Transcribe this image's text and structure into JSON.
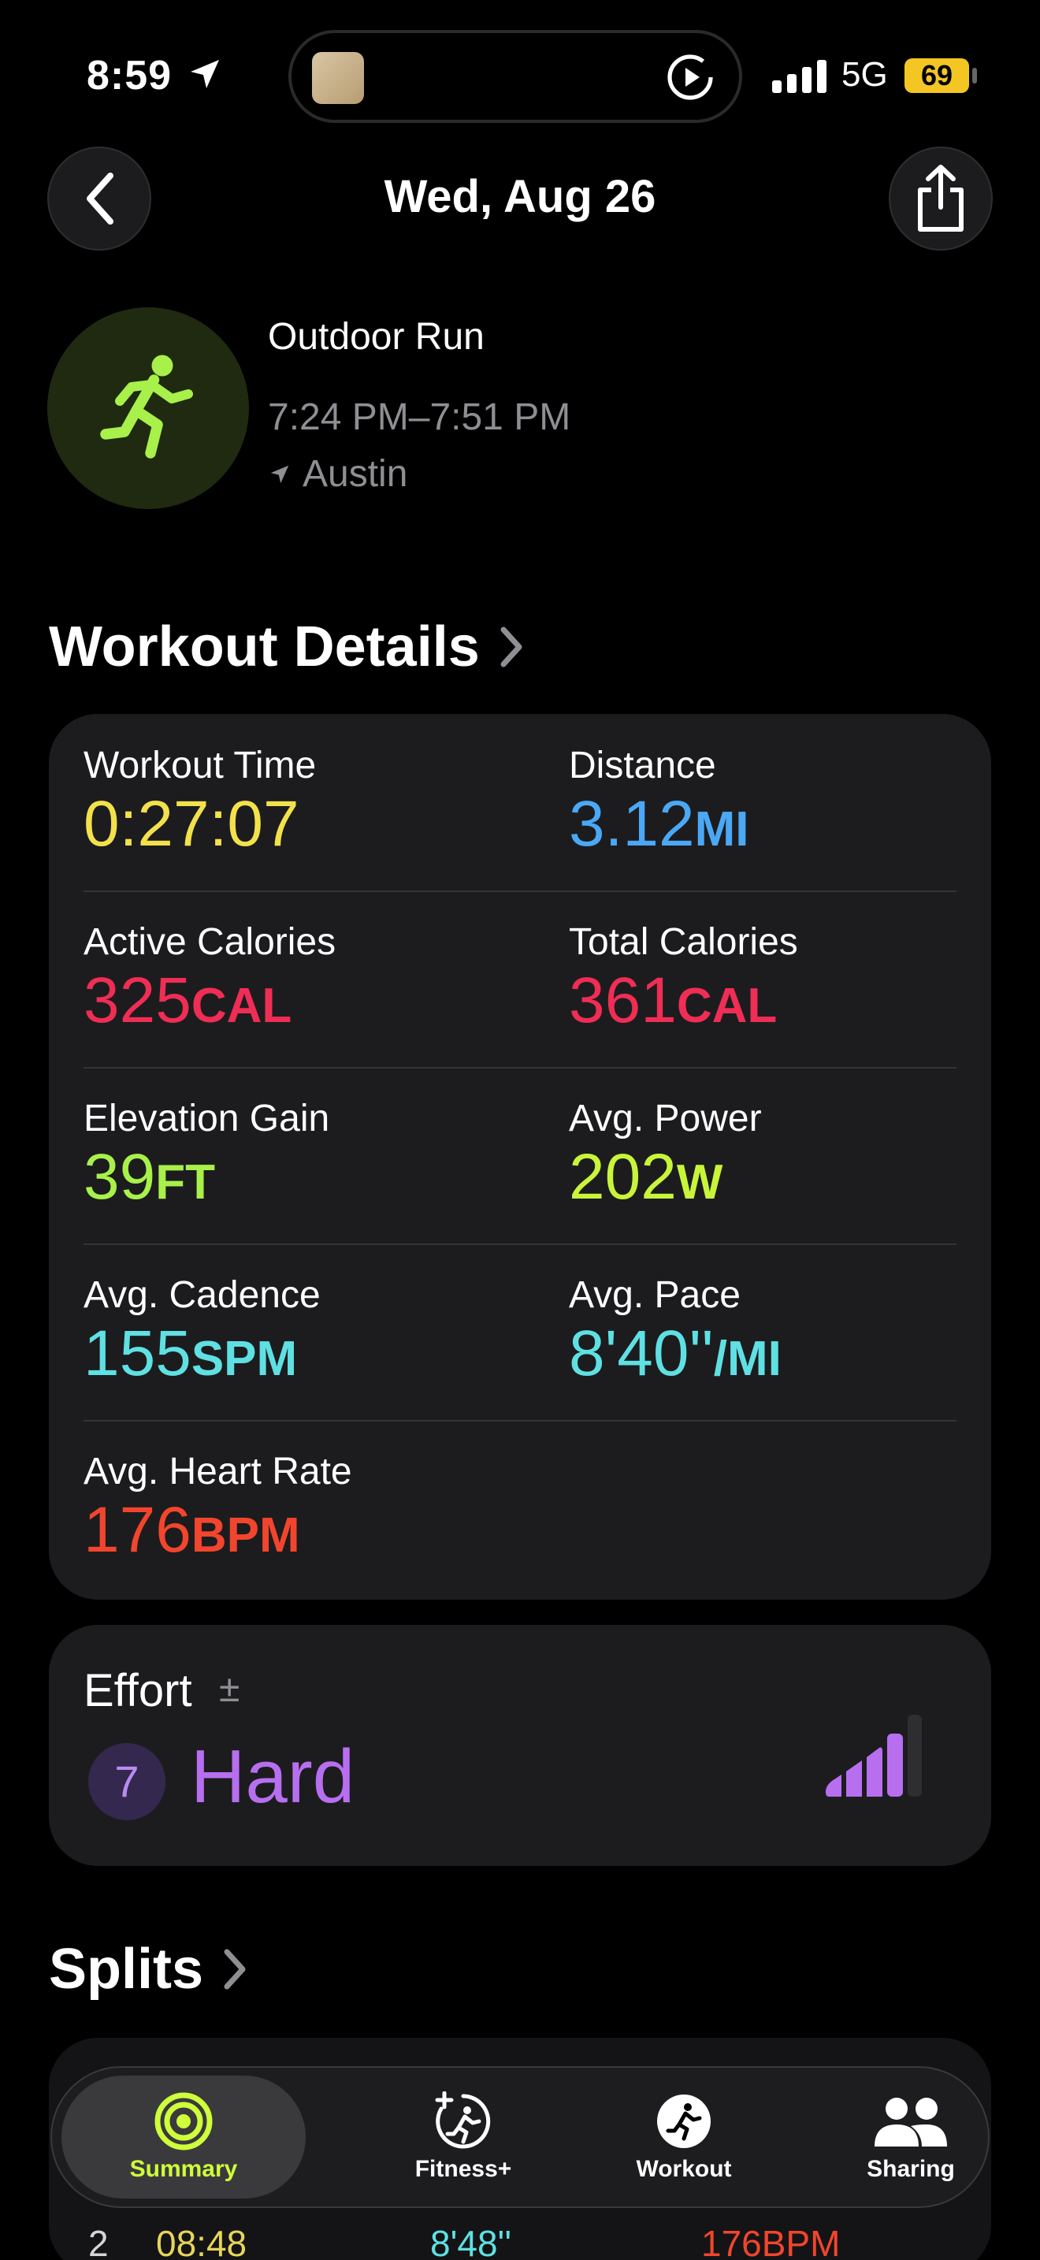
{
  "status_bar": {
    "time": "8:59",
    "network": "5G",
    "battery": "69"
  },
  "header": {
    "title": "Wed, Aug 26"
  },
  "workout": {
    "name": "Outdoor Run",
    "time_range": "7:24 PM–7:51 PM",
    "location": "Austin"
  },
  "details": {
    "title": "Workout Details",
    "metrics": [
      {
        "label": "Workout Time",
        "value": "0:27:07",
        "unit": "",
        "color": "#f2e14b"
      },
      {
        "label": "Distance",
        "value": "3.12",
        "unit": "MI",
        "color": "#4aa8f5"
      },
      {
        "label": "Active Calories",
        "value": "325",
        "unit": "CAL",
        "color": "#ef2d55"
      },
      {
        "label": "Total Calories",
        "value": "361",
        "unit": "CAL",
        "color": "#ef2d55"
      },
      {
        "label": "Elevation Gain",
        "value": "39",
        "unit": "FT",
        "color": "#a8f04a"
      },
      {
        "label": "Avg. Power",
        "value": "202",
        "unit": "W",
        "color": "#c8f53a"
      },
      {
        "label": "Avg. Cadence",
        "value": "155",
        "unit": "SPM",
        "color": "#5fe0e3"
      },
      {
        "label": "Avg. Pace",
        "value": "8'40''",
        "unit": "/MI",
        "color": "#5fe0e3"
      },
      {
        "label": "Avg. Heart Rate",
        "value": "176",
        "unit": "BPM",
        "color": "#f2452d"
      }
    ]
  },
  "effort": {
    "label": "Effort",
    "adjust_icon": "±",
    "score": "7",
    "level": "Hard",
    "color": "#b76ff0"
  },
  "splits": {
    "title": "Splits",
    "row": {
      "index": "2",
      "time": "08:48",
      "pace": "8'48''",
      "heart_rate": "176BPM"
    }
  },
  "tabbar": {
    "tabs": [
      {
        "label": "Summary",
        "icon": "summary-rings-icon",
        "active": true
      },
      {
        "label": "Fitness+",
        "icon": "fitness-plus-icon",
        "active": false
      },
      {
        "label": "Workout",
        "icon": "workout-runner-icon",
        "active": false
      },
      {
        "label": "Sharing",
        "icon": "sharing-people-icon",
        "active": false
      }
    ]
  }
}
